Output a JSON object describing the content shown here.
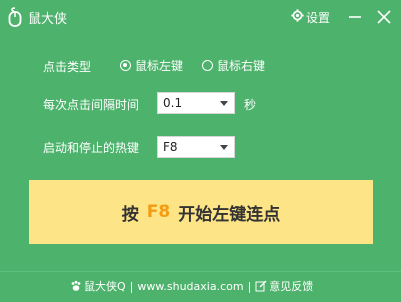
{
  "app": {
    "title": "鼠大侠",
    "settings_label": "设置"
  },
  "form": {
    "click_type_label": "点击类型",
    "options": [
      "鼠标左键",
      "鼠标右键"
    ],
    "selected_option": "鼠标左键",
    "interval_label": "每次点击间隔时间",
    "interval_value": "0.1",
    "interval_unit": "秒",
    "hotkey_label": "启动和停止的热键",
    "hotkey_value": "F8"
  },
  "action": {
    "prefix": "按",
    "key": "F8",
    "suffix": "开始左键连点"
  },
  "footer": {
    "brand_link": "鼠大侠Q",
    "separator": "|",
    "website": "www.shudaxia.com",
    "feedback_link": "意见反馈"
  },
  "colors": {
    "background": "#4db36c",
    "button": "#fde486",
    "key_accent": "#f39c12"
  }
}
